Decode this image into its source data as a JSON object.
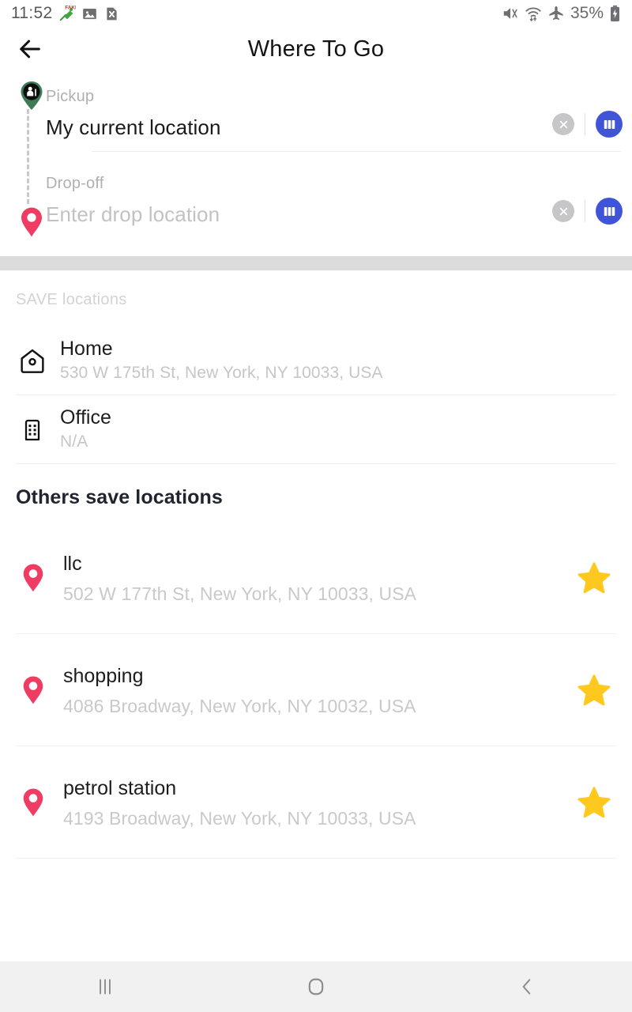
{
  "statusbar": {
    "time": "11:52",
    "battery_percent": "35%",
    "left_icons": [
      "fake-gps-icon",
      "image-icon",
      "document-x-icon"
    ],
    "right_icons": [
      "mute-icon",
      "wifi-transfer-icon",
      "airplane-mode-icon",
      "battery-charging-icon"
    ]
  },
  "header": {
    "title": "Where To Go",
    "back_icon": "arrow-left-icon"
  },
  "route": {
    "pickup": {
      "label": "Pickup",
      "value": "My current location",
      "is_placeholder": false,
      "pin_icon": "pickup-person-pin-icon",
      "pin_color": "#2f5f44",
      "clear_icon": "close-circle-icon",
      "map_icon": "map-panels-icon"
    },
    "dropoff": {
      "label": "Drop-off",
      "value": "Enter drop location",
      "is_placeholder": true,
      "pin_icon": "map-pin-icon",
      "pin_color": "#ef3c63",
      "clear_icon": "close-circle-icon",
      "map_icon": "map-panels-icon"
    }
  },
  "saved": {
    "heading": "SAVE locations",
    "items": [
      {
        "icon": "home-icon",
        "title": "Home",
        "address": "530 W 175th St, New York, NY 10033, USA"
      },
      {
        "icon": "office-building-icon",
        "title": "Office",
        "address": "N/A"
      }
    ]
  },
  "others": {
    "heading": "Others save locations",
    "items": [
      {
        "icon": "map-pin-icon",
        "title": "llc",
        "address": "502 W 177th St, New York, NY 10033, USA",
        "star_icon": "star-filled-icon"
      },
      {
        "icon": "map-pin-icon",
        "title": "shopping",
        "address": "4086 Broadway, New York, NY 10032, USA",
        "star_icon": "star-filled-icon"
      },
      {
        "icon": "map-pin-icon",
        "title": "petrol station",
        "address": "4193 Broadway, New York, NY 10033, USA",
        "star_icon": "star-filled-icon"
      }
    ]
  },
  "navbar": {
    "recents_icon": "recents-icon",
    "home_icon": "home-square-icon",
    "back_icon": "chevron-left-icon"
  },
  "colors": {
    "accent_blue": "#4054d8",
    "pin_pink": "#ef3c63",
    "pin_green": "#2f5f44",
    "star_yellow": "#ffc81e",
    "band_gray": "#dcdcdc"
  }
}
